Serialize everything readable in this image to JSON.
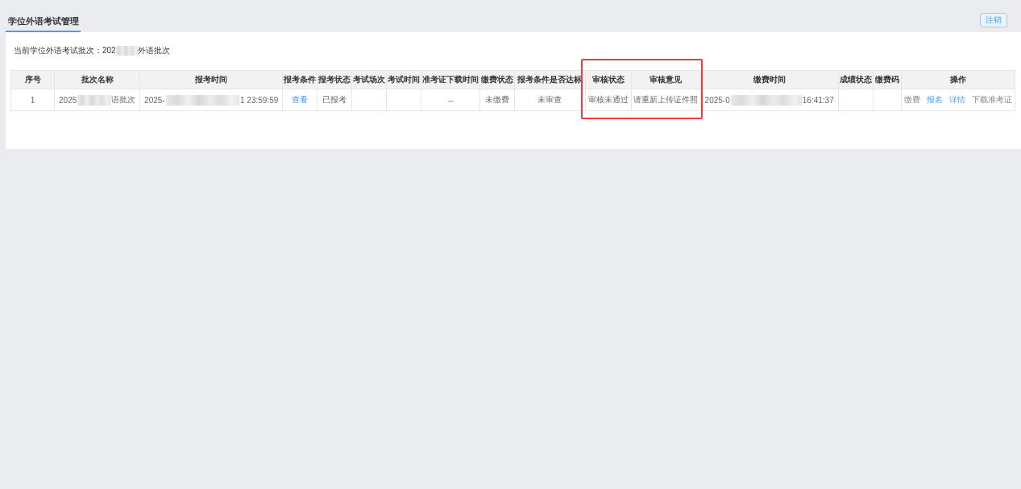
{
  "header": {
    "tabs": [
      {
        "label": "学位外语考试管理",
        "selected": true
      }
    ],
    "logout_button": "注销"
  },
  "current_batch": {
    "text_parts": [
      "当前学位外语考试批次：202",
      "外语批次"
    ]
  },
  "table": {
    "columns": [
      {
        "label": "序号",
        "highlighted": false
      },
      {
        "label": "批次名称",
        "highlighted": false
      },
      {
        "label": "报考时间",
        "highlighted": false
      },
      {
        "label": "报考条件",
        "highlighted": false
      },
      {
        "label": "报考状态",
        "highlighted": false
      },
      {
        "label": "考试场次",
        "highlighted": false
      },
      {
        "label": "考试时间",
        "highlighted": false
      },
      {
        "label": "准考证下载时间",
        "highlighted": false
      },
      {
        "label": "缴费状态",
        "highlighted": false
      },
      {
        "label": "报考条件是否达标",
        "highlighted": false
      },
      {
        "label": "审核状态",
        "highlighted": true
      },
      {
        "label": "审核意见",
        "highlighted": true
      },
      {
        "label": "缴费时间",
        "highlighted": false
      },
      {
        "label": "成绩状态",
        "highlighted": false
      },
      {
        "label": "缴费码",
        "highlighted": false
      },
      {
        "label": "操作",
        "highlighted": false
      }
    ],
    "rows": [
      {
        "cells": [
          {
            "kind": "text",
            "text": "1"
          },
          {
            "kind": "redacted",
            "text_parts": [
              "2025",
              "语批次"
            ]
          },
          {
            "kind": "redacted",
            "text_parts": [
              "2025-",
              "1 23:59:59"
            ]
          },
          {
            "kind": "link",
            "text": "查看"
          },
          {
            "kind": "text",
            "text": "已报考"
          },
          {
            "kind": "empty"
          },
          {
            "kind": "empty"
          },
          {
            "kind": "text",
            "text": "--"
          },
          {
            "kind": "text",
            "text": "未缴费"
          },
          {
            "kind": "text",
            "text": "未审查"
          },
          {
            "kind": "text",
            "text": "审核未通过"
          },
          {
            "kind": "text",
            "text": "请重新上传证件照"
          },
          {
            "kind": "redacted",
            "text_parts": [
              "2025-0",
              "16:41:37"
            ]
          },
          {
            "kind": "empty"
          },
          {
            "kind": "empty"
          },
          {
            "kind": "actions",
            "actions": [
              {
                "label": "缴费",
                "disabled": true
              },
              {
                "label": "报名",
                "disabled": false
              },
              {
                "label": "详情",
                "disabled": false
              },
              {
                "label": "下载准考证",
                "disabled": true
              }
            ]
          }
        ]
      }
    ]
  }
}
